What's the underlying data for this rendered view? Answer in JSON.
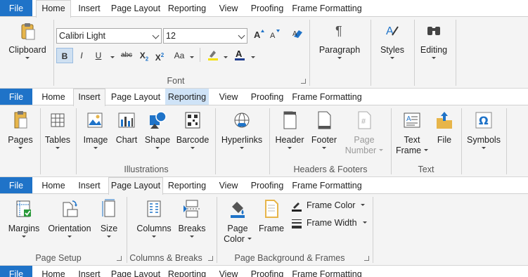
{
  "tabs": {
    "file": "File",
    "home": "Home",
    "insert": "Insert",
    "page_layout": "Page Layout",
    "reporting": "Reporting",
    "view": "View",
    "proofing": "Proofing",
    "frame_formatting": "Frame Formatting"
  },
  "home_ribbon": {
    "clipboard": "Clipboard",
    "font_name": "Calibri Light",
    "font_size": "12",
    "font_group": "Font",
    "paragraph": "Paragraph",
    "styles": "Styles",
    "editing": "Editing",
    "bold": "B",
    "italic": "I",
    "underline": "U",
    "strike": "abc",
    "subscript": "X",
    "superscript": "X",
    "change_case": "Aa"
  },
  "insert_ribbon": {
    "pages": "Pages",
    "tables": "Tables",
    "image": "Image",
    "chart": "Chart",
    "shape": "Shape",
    "barcode": "Barcode",
    "illustrations": "Illustrations",
    "hyperlinks": "Hyperlinks",
    "header": "Header",
    "footer": "Footer",
    "page_number_line1": "Page",
    "page_number_line2": "Number",
    "headers_footers": "Headers & Footers",
    "text_frame_line1": "Text",
    "text_frame_line2": "Frame",
    "file_btn": "File",
    "text_group": "Text",
    "symbols": "Symbols"
  },
  "layout_ribbon": {
    "margins": "Margins",
    "orientation": "Orientation",
    "size": "Size",
    "page_setup": "Page Setup",
    "columns": "Columns",
    "breaks": "Breaks",
    "columns_breaks": "Columns & Breaks",
    "page_color_line1": "Page",
    "page_color_line2": "Color",
    "frame": "Frame",
    "frame_color": "Frame Color",
    "frame_width": "Frame Width",
    "page_bg_frames": "Page Background & Frames"
  },
  "colors": {
    "file_tab": "#1f73c8",
    "ribbon_bg": "#f4f4f4",
    "highlight": "#cfe3f7"
  }
}
